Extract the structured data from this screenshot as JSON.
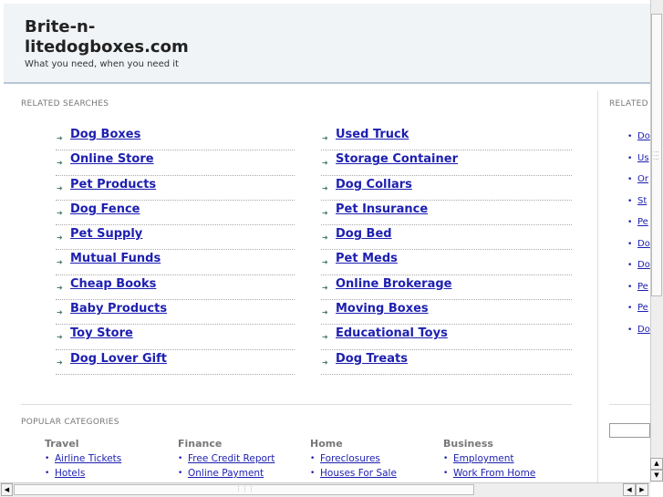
{
  "header": {
    "title": "Brite-n-litedogboxes.com",
    "tagline": "What you need, when you need it"
  },
  "related_searches": {
    "label": "RELATED SEARCHES",
    "left_column": [
      "Dog Boxes",
      "Online Store",
      "Pet Products",
      "Dog Fence",
      "Pet Supply",
      "Mutual Funds",
      "Cheap Books",
      "Baby Products",
      "Toy Store",
      "Dog Lover Gift"
    ],
    "right_column": [
      "Used Truck",
      "Storage Container",
      "Dog Collars",
      "Pet Insurance",
      "Dog Bed",
      "Pet Meds",
      "Online Brokerage",
      "Moving Boxes",
      "Educational Toys",
      "Dog Treats"
    ]
  },
  "right_panel": {
    "label": "RELATED",
    "items": [
      "Do",
      "Us",
      "Or",
      "St",
      "Pe",
      "Do",
      "Do",
      "Pe",
      "Pe",
      "Do"
    ]
  },
  "popular_categories": {
    "label": "POPULAR CATEGORIES",
    "columns": [
      {
        "title": "Travel",
        "items": [
          "Airline Tickets",
          "Hotels"
        ]
      },
      {
        "title": "Finance",
        "items": [
          "Free Credit Report",
          "Online Payment"
        ]
      },
      {
        "title": "Home",
        "items": [
          "Foreclosures",
          "Houses For Sale"
        ]
      },
      {
        "title": "Business",
        "items": [
          "Employment",
          "Work From Home"
        ]
      }
    ]
  },
  "icons": {
    "arrow": "➜",
    "bullet": "•",
    "scroll_up": "▲",
    "scroll_down": "▼",
    "scroll_left": "◀",
    "scroll_right": "▶",
    "grip": "⋮⋮⋮"
  }
}
